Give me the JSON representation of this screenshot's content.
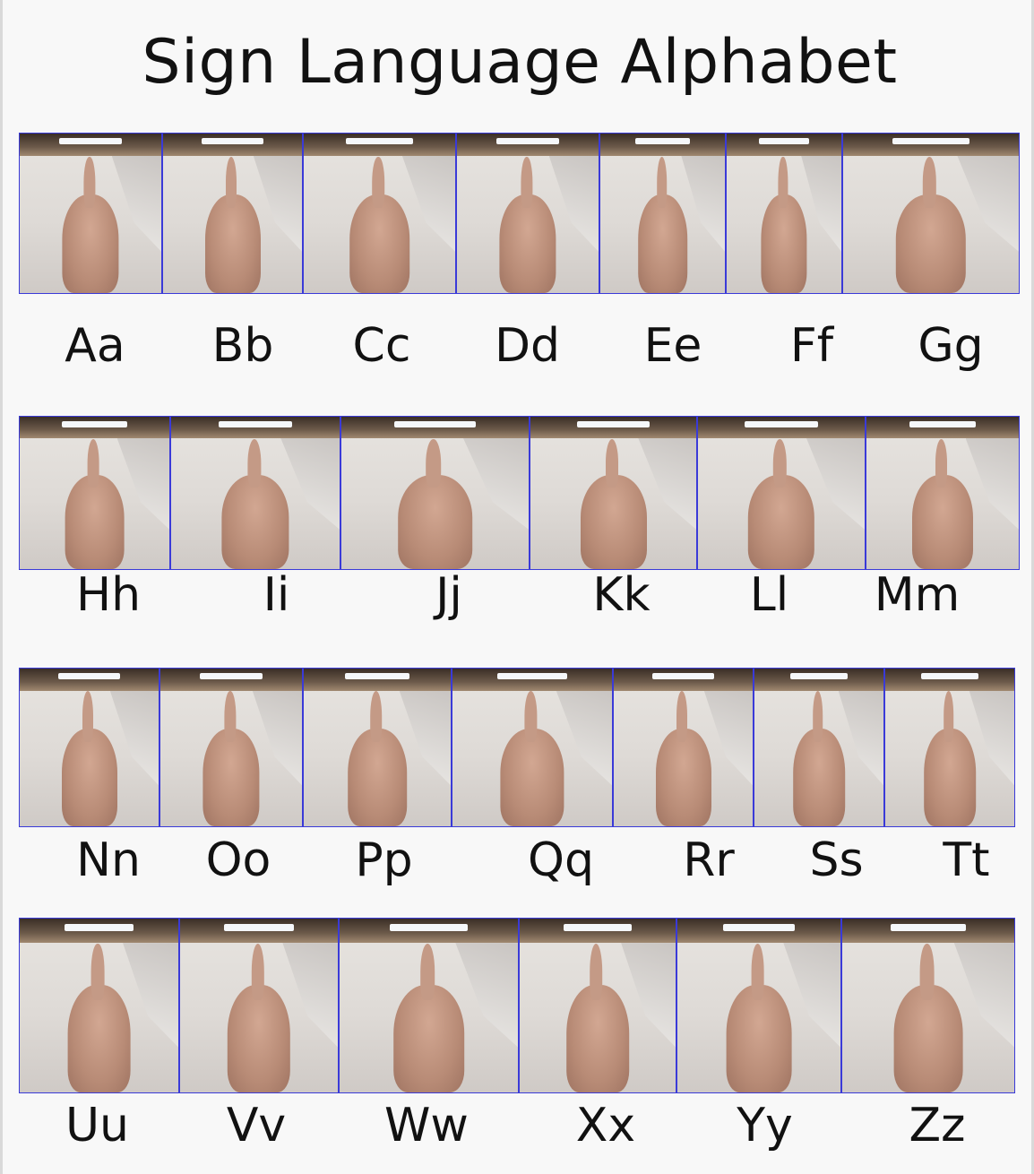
{
  "title": "Sign Language Alphabet",
  "icon": "hand-sign-photo",
  "rows": [
    {
      "letters": [
        {
          "label": "Aa"
        },
        {
          "label": "Bb"
        },
        {
          "label": "Cc"
        },
        {
          "label": "Dd"
        },
        {
          "label": "Ee"
        },
        {
          "label": "Ff"
        },
        {
          "label": "Gg"
        }
      ]
    },
    {
      "letters": [
        {
          "label": "Hh"
        },
        {
          "label": "Ii"
        },
        {
          "label": "Jj"
        },
        {
          "label": "Kk"
        },
        {
          "label": "Ll"
        },
        {
          "label": "Mm"
        }
      ]
    },
    {
      "letters": [
        {
          "label": "Nn"
        },
        {
          "label": "Oo"
        },
        {
          "label": "Pp"
        },
        {
          "label": "Qq"
        },
        {
          "label": "Rr"
        },
        {
          "label": "Ss"
        },
        {
          "label": "Tt"
        }
      ]
    },
    {
      "letters": [
        {
          "label": "Uu"
        },
        {
          "label": "Vv"
        },
        {
          "label": "Ww"
        },
        {
          "label": "Xx"
        },
        {
          "label": "Yy"
        },
        {
          "label": "Zz"
        }
      ]
    }
  ]
}
